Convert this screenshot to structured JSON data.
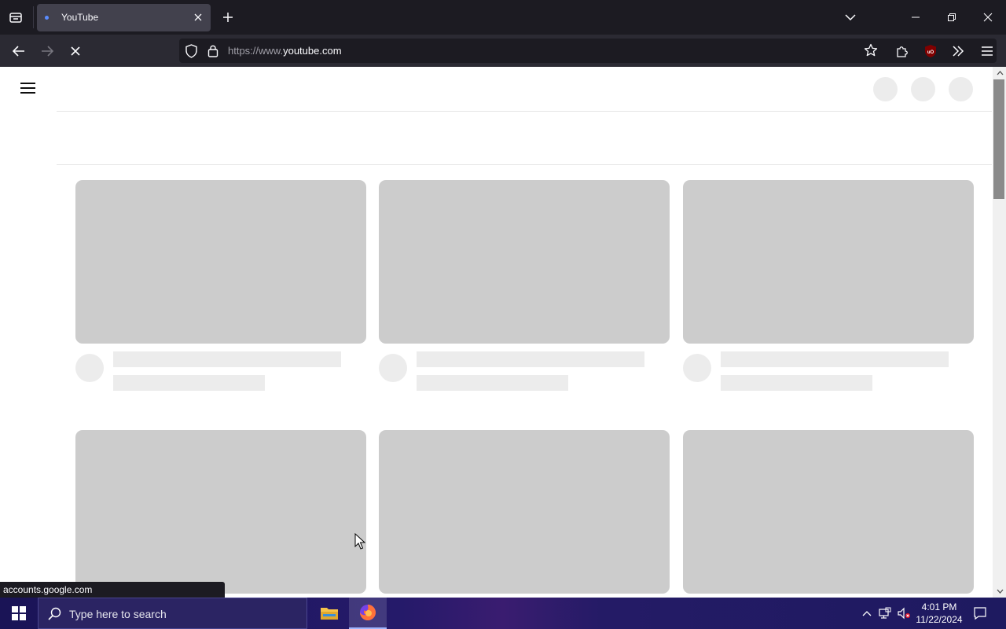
{
  "browser": {
    "tab": {
      "title": "YouTube"
    },
    "url": {
      "scheme": "https://",
      "host_prefix": "www.",
      "host": "youtube.com"
    }
  },
  "status_bar": {
    "text": "accounts.google.com"
  },
  "taskbar": {
    "search_placeholder": "Type here to search",
    "clock_time": "4:01 PM",
    "clock_date": "11/22/2024"
  },
  "colors": {
    "skeleton_thumb": "#cccccc",
    "skeleton_text": "#ececec",
    "chrome_dark": "#1c1b22",
    "chrome_nav": "#2b2a33"
  },
  "icons": {
    "tab_list": "tab-list-icon",
    "close_tab": "close-icon",
    "new_tab": "plus-icon",
    "back": "back-arrow-icon",
    "forward": "forward-arrow-icon",
    "stop": "stop-icon",
    "tracking": "shield-icon",
    "lock": "lock-icon",
    "bookmark": "star-icon",
    "extensions": "puzzle-icon",
    "ublock": "ublock-icon",
    "overflow": "chevron-double-right-icon",
    "menu": "hamburger-icon"
  }
}
